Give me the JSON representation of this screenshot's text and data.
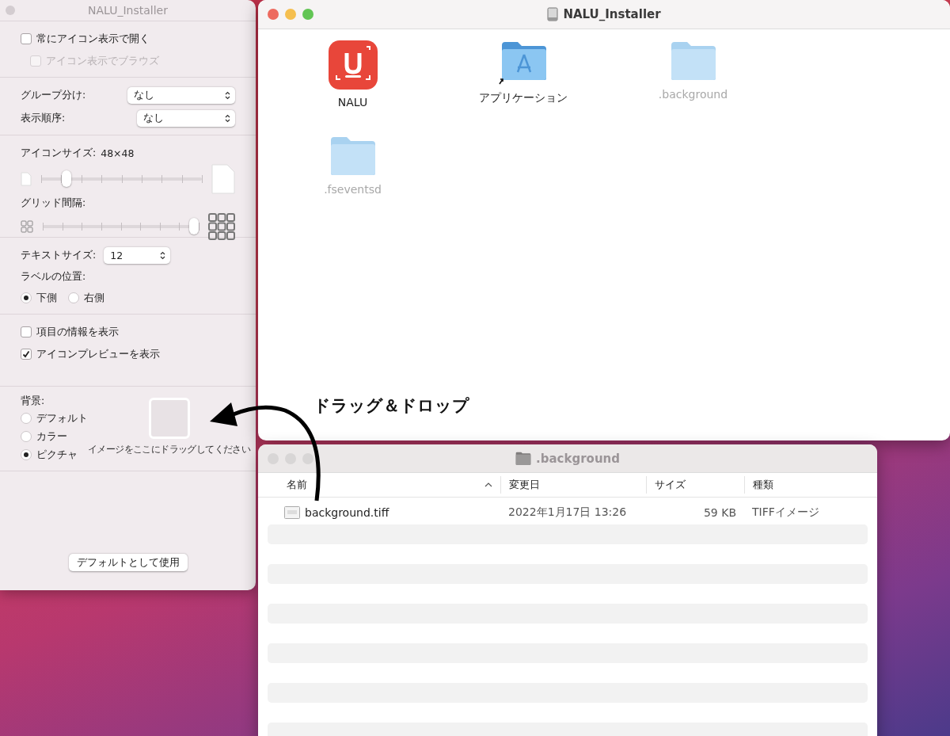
{
  "view_options": {
    "title": "NALU_Installer",
    "top_checkboxes": [
      {
        "label": "常にアイコン表示で開く",
        "checked": false,
        "disabled": false
      },
      {
        "label": "アイコン表示でブラウズ",
        "checked": false,
        "disabled": true
      }
    ],
    "selects": [
      {
        "label": "グループ分け:",
        "value": "なし"
      },
      {
        "label": "表示順序:",
        "value": "なし"
      }
    ],
    "icon_size": {
      "label": "アイコンサイズ:",
      "value": "48×48",
      "level": 0.16
    },
    "grid_spacing": {
      "label": "グリッド間隔:",
      "level": 0.97
    },
    "text_size": {
      "label": "テキストサイズ:",
      "value": "12"
    },
    "label_position": {
      "label": "ラベルの位置:",
      "options": [
        {
          "label": "下側",
          "selected": true
        },
        {
          "label": "右側",
          "selected": false
        }
      ]
    },
    "bottom_checkboxes": [
      {
        "label": "項目の情報を表示",
        "checked": false,
        "disabled": false
      },
      {
        "label": "アイコンプレビューを表示",
        "checked": true,
        "disabled": false
      }
    ],
    "background": {
      "label": "背景:",
      "options": [
        {
          "label": "デフォルト",
          "selected": false
        },
        {
          "label": "カラー",
          "selected": false
        },
        {
          "label": "ピクチャ",
          "selected": true
        }
      ],
      "drop_hint": "イメージをここにドラッグしてください"
    },
    "default_button": "デフォルトとして使用"
  },
  "finder": {
    "title": "NALU_Installer",
    "items": [
      {
        "name": "NALU",
        "kind": "app",
        "hidden": false
      },
      {
        "name": "アプリケーション",
        "kind": "apps-folder",
        "hidden": false
      },
      {
        "name": ".background",
        "kind": "folder",
        "hidden": true
      },
      {
        "name": ".fseventsd",
        "kind": "folder",
        "hidden": true
      }
    ]
  },
  "list_window": {
    "title": ".background",
    "columns": [
      "名前",
      "変更日",
      "サイズ",
      "種類"
    ],
    "rows": [
      {
        "name": "background.tiff",
        "date": "2022年1月17日 13:26",
        "size": "59 KB",
        "type": "TIFFイメージ"
      }
    ]
  },
  "annotation": {
    "text": "ドラッグ＆ドロップ"
  }
}
